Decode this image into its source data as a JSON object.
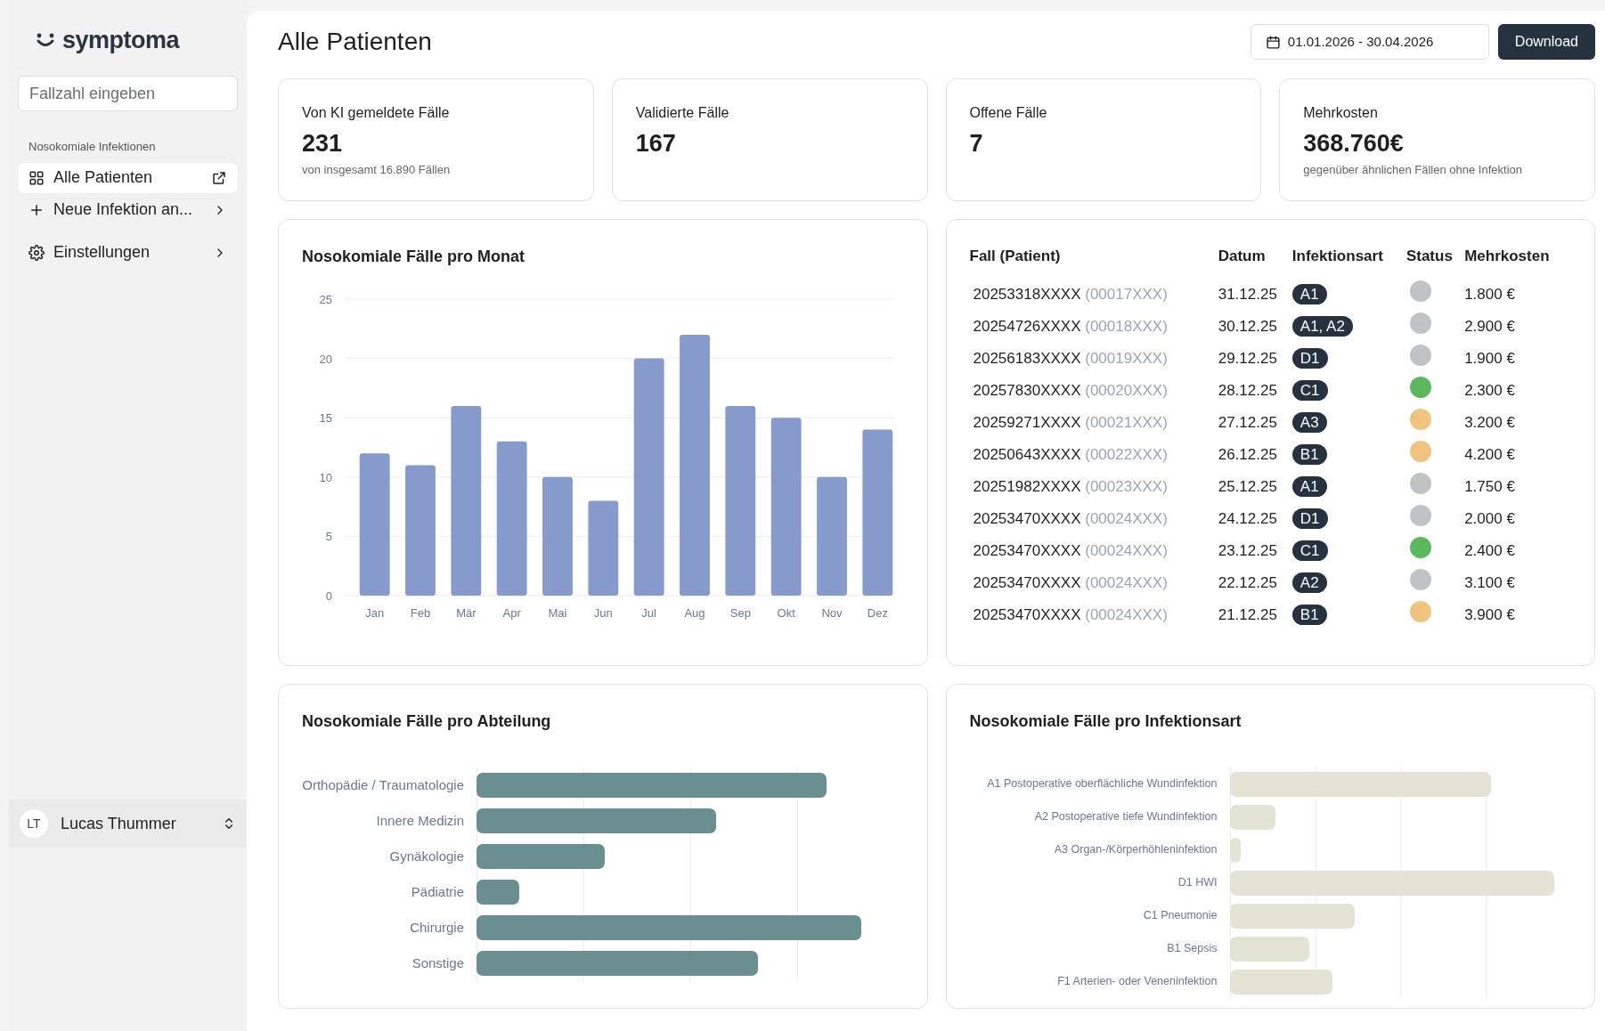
{
  "sidebar": {
    "logo": "symptoma",
    "search": {
      "placeholder": "Fallzahl eingeben"
    },
    "section_label": "Nosokomiale Infektionen",
    "items": [
      {
        "kind": "link",
        "label": "Alle Patienten",
        "selected": true
      },
      {
        "kind": "submenu",
        "label": "Neue Infektion an...",
        "selected": false
      },
      {
        "kind": "submenu",
        "label": "Einstellungen",
        "selected": false
      }
    ],
    "user": {
      "initials": "LT",
      "name": "Lucas Thummer"
    }
  },
  "header": {
    "title": "Alle Patienten",
    "date_range": "01.01.2026 - 30.04.2026",
    "download": "Download"
  },
  "stats": [
    {
      "label": "Von KI gemeldete Fälle",
      "value": "231",
      "note": "von insgesamt 16.890 Fällen"
    },
    {
      "label": "Validierte Fälle",
      "value": "167"
    },
    {
      "label": "Offene Fälle",
      "value": "7"
    },
    {
      "label": "Mehrkosten",
      "value": "368.760€",
      "note": "gegenüber ähnlichen Fällen ohne Infektion"
    }
  ],
  "monthly": {
    "title": "Nosokomiale Fälle pro Monat",
    "chart_data": {
      "type": "bar",
      "categories": [
        "Jan",
        "Feb",
        "Mär",
        "Apr",
        "Mai",
        "Jun",
        "Jul",
        "Aug",
        "Sep",
        "Okt",
        "Nov",
        "Dez"
      ],
      "grid": true,
      "series": [
        {
          "color": "#869bcc",
          "values": [
            12,
            11,
            16,
            13,
            10,
            8,
            20,
            22,
            16,
            15,
            10,
            14
          ]
        }
      ],
      "ylim": [
        0,
        25
      ],
      "yticks": [
        0,
        5,
        10,
        15,
        20,
        25
      ]
    }
  },
  "table": {
    "columns": [
      "Fall (Patient)",
      "Datum",
      "Infektionsart",
      "Status",
      "Mehrkosten"
    ],
    "rows": [
      {
        "case": "20253318XXXX",
        "patient": "(00017XXX)",
        "date": "31.12.25",
        "types": "A1",
        "color": "#bfc3c6",
        "cost": "1.800 €"
      },
      {
        "case": "20254726XXXX",
        "patient": "(00018XXX)",
        "date": "30.12.25",
        "types": "A1, A2",
        "color": "#bfc3c6",
        "cost": "2.900 €"
      },
      {
        "case": "20256183XXXX",
        "patient": "(00019XXX)",
        "date": "29.12.25",
        "types": "D1",
        "color": "#bfc3c6",
        "cost": "1.900 €"
      },
      {
        "case": "20257830XXXX",
        "patient": "(00020XXX)",
        "date": "28.12.25",
        "types": "C1",
        "color": "#5cb85c",
        "cost": "2.300 €"
      },
      {
        "case": "20259271XXXX",
        "patient": "(00021XXX)",
        "date": "27.12.25",
        "types": "A3",
        "color": "#f0c47e",
        "cost": "3.200 €"
      },
      {
        "case": "20250643XXXX",
        "patient": "(00022XXX)",
        "date": "26.12.25",
        "types": "B1",
        "color": "#f0c47e",
        "cost": "4.200 €"
      },
      {
        "case": "20251982XXXX",
        "patient": "(00023XXX)",
        "date": "25.12.25",
        "types": "A1",
        "color": "#bfc3c6",
        "cost": "1.750 €"
      },
      {
        "case": "20253470XXXX",
        "patient": "(00024XXX)",
        "date": "24.12.25",
        "types": "D1",
        "color": "#bfc3c6",
        "cost": "2.000 €"
      },
      {
        "case": "20253470XXXX",
        "patient": "(00024XXX)",
        "date": "23.12.25",
        "types": "C1",
        "color": "#5cb85c",
        "cost": "2.400 €"
      },
      {
        "case": "20253470XXXX",
        "patient": "(00024XXX)",
        "date": "22.12.25",
        "types": "A2",
        "color": "#bfc3c6",
        "cost": "3.100 €"
      },
      {
        "case": "20253470XXXX",
        "patient": "(00024XXX)",
        "date": "21.12.25",
        "types": "B1",
        "color": "#f0c47e",
        "cost": "3.900 €"
      }
    ]
  },
  "departments": {
    "title": "Nosokomiale Fälle pro Abteilung",
    "labels": [
      "Orthopädie / Traumatologie",
      "Innere Medizin",
      "Gynäkologie",
      "Pädiatrie",
      "Chirurgie",
      "Sonstige"
    ]
  },
  "infection_types": {
    "title": "Nosokomiale Fälle pro Infektionsart",
    "labels": [
      "A1 Postoperative oberflächliche Wundinfektion",
      "A2 Postoperative tiefe Wundinfektion",
      "A3 Organ-/Körperhöhleninfektion",
      "D1 HWI",
      "C1 Pneumonie",
      "B1 Sepsis",
      "F1 Arterien- oder Veneninfektion"
    ]
  }
}
